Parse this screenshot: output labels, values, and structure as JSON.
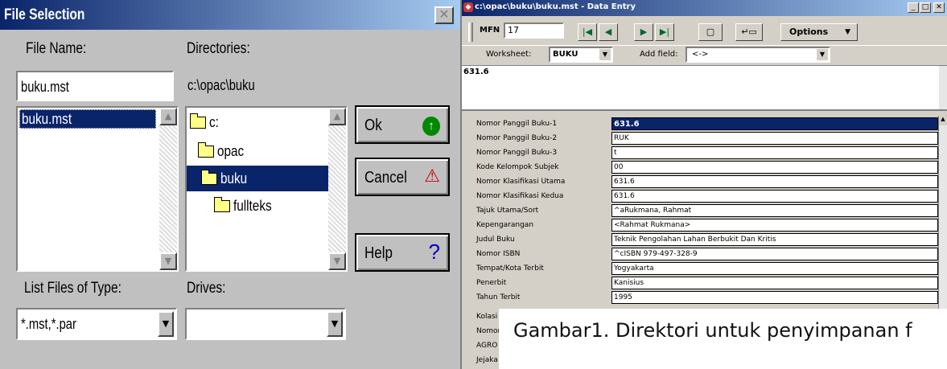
{
  "file_dialog": {
    "title": "File Selection",
    "close_glyph": "✕",
    "file_name_label": "File Name:",
    "directories_label": "Directories:",
    "file_name_value": "buku.mst",
    "current_dir": "c:\\opac\\buku",
    "files": [
      "buku.mst"
    ],
    "directories": [
      "c:",
      "opac",
      "buku",
      "fullteks"
    ],
    "selected_directory": "buku",
    "list_types_label": "List Files of Type:",
    "drives_label": "Drives:",
    "file_type_value": "*.mst,*.par",
    "drive_value": "",
    "buttons": {
      "ok": "Ok",
      "cancel": "Cancel",
      "help": "Help"
    },
    "icons": {
      "ok": "up-arrow-icon",
      "cancel": "warning-icon",
      "help": "question-icon"
    }
  },
  "data_entry": {
    "title": "c:\\opac\\buku\\buku.mst - Data Entry",
    "mfn_label": "MFN",
    "mfn_value": "17",
    "options_label": "Options",
    "worksheet_label": "Worksheet:",
    "worksheet_value": "BUKU",
    "add_field_label": "Add field:",
    "add_field_value": "<->",
    "editor_text": "631.6",
    "fields": [
      {
        "label": "Nomor Panggil Buku-1",
        "value": "631.6"
      },
      {
        "label": "Nomor Panggil Buku-2",
        "value": "RUK"
      },
      {
        "label": "Nomor Panggil Buku-3",
        "value": "t"
      },
      {
        "label": "Kode Kelompok Subjek",
        "value": "00"
      },
      {
        "label": "Nomor Klasifikasi Utama",
        "value": "631.6"
      },
      {
        "label": "Nomor Klasifikasi Kedua",
        "value": "631.6"
      },
      {
        "label": "Tajuk Utama/Sort",
        "value": "^aRukmana, Rahmat"
      },
      {
        "label": "Kepengarangan",
        "value": "<Rahmat Rukmana>"
      },
      {
        "label": "Judul Buku",
        "value": "Teknik Pengolahan Lahan Berbukit Dan Kritis"
      },
      {
        "label": "Nomor ISBN",
        "value": "^cISBN 979-497-328-9"
      },
      {
        "label": "Tempat/Kota Terbit",
        "value": "Yogyakarta"
      },
      {
        "label": "Penerbit",
        "value": "Kanisius"
      },
      {
        "label": "Tahun Terbit",
        "value": "1995"
      },
      {
        "label": "Kolasi",
        "value": ""
      },
      {
        "label": "Nomor",
        "value": ""
      },
      {
        "label": "AGRO",
        "value": ""
      },
      {
        "label": "Jejaka",
        "value": ""
      }
    ]
  },
  "caption": "Gambar1.  Direktori untuk penyimpanan f"
}
